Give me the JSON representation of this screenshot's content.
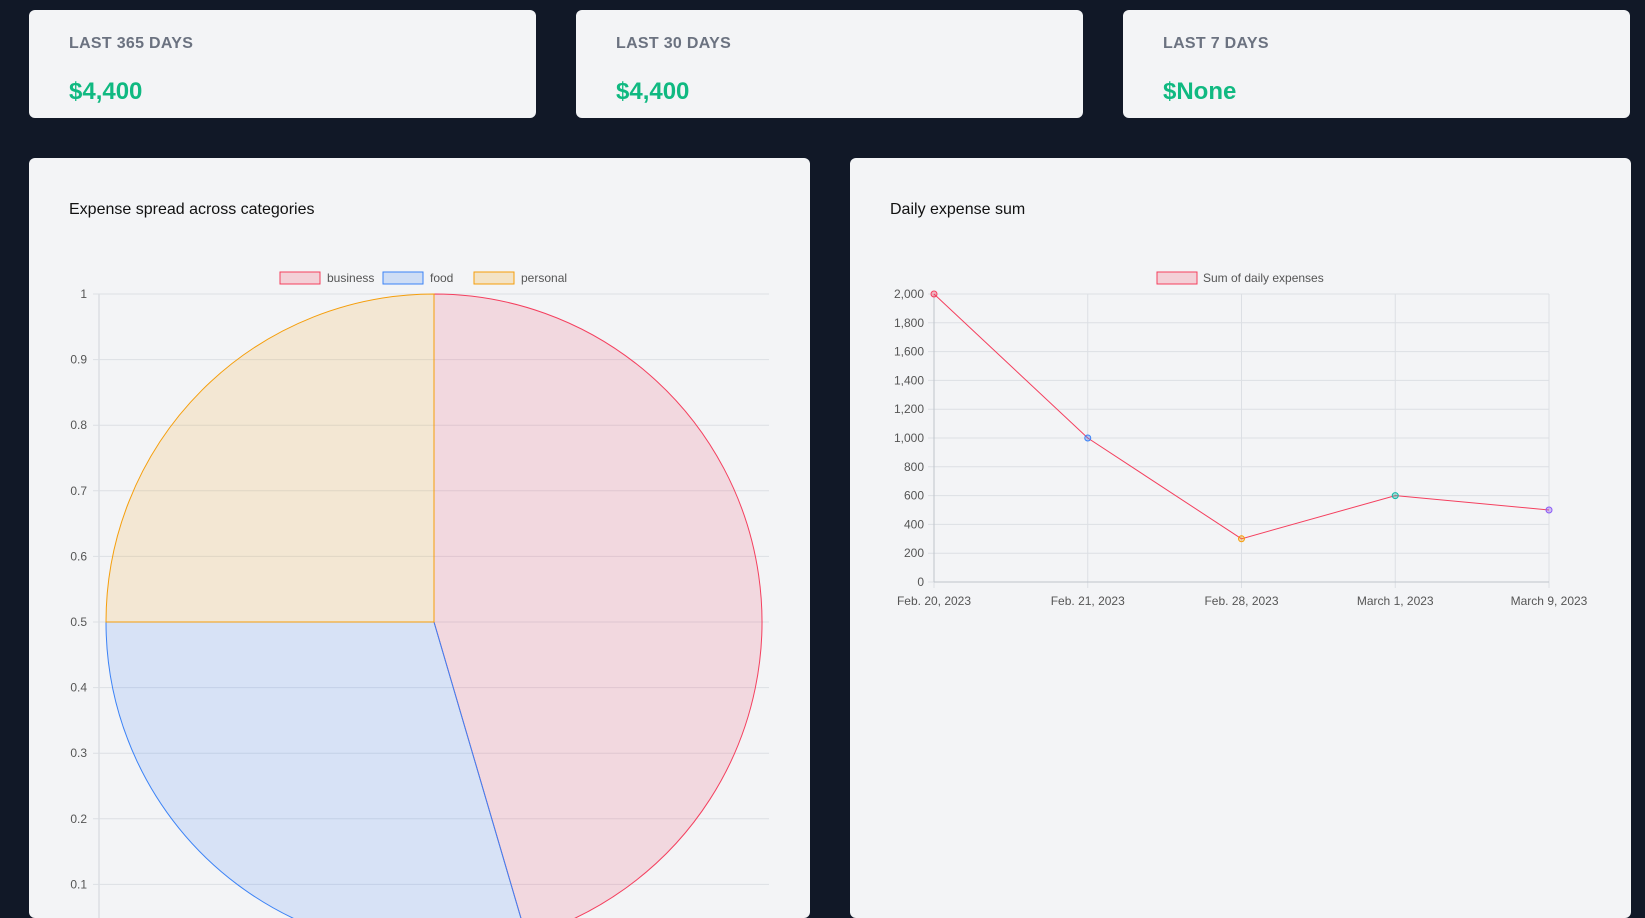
{
  "stats": [
    {
      "title": "LAST 365 DAYS",
      "value": "$4,400"
    },
    {
      "title": "LAST 30 DAYS",
      "value": "$4,400"
    },
    {
      "title": "LAST 7 DAYS",
      "value": "$None"
    }
  ],
  "pie_card": {
    "title": "Expense spread across categories"
  },
  "line_card": {
    "title": "Daily expense sum"
  },
  "colors": {
    "page_bg": "#111827",
    "card_bg": "#f3f4f6",
    "stat_value": "#10b981",
    "business": "#f43f5e",
    "food": "#3b82f6",
    "personal": "#f59e0b",
    "line": "#f43f5e"
  },
  "chart_data": [
    {
      "type": "pie",
      "title": "Expense spread across categories",
      "categories": [
        "business",
        "food",
        "personal"
      ],
      "values": [
        2000,
        1300,
        1100
      ],
      "y_ticks": [
        "1",
        "0.9",
        "0.8",
        "0.7",
        "0.6",
        "0.5",
        "0.4",
        "0.3",
        "0.2",
        "0.1"
      ],
      "legend": "top-center",
      "grid": true
    },
    {
      "type": "line",
      "title": "Daily expense sum",
      "series": [
        {
          "name": "Sum of daily expenses",
          "x": [
            "Feb. 20, 2023",
            "Feb. 21, 2023",
            "Feb. 28, 2023",
            "March 1, 2023",
            "March 9, 2023"
          ],
          "values": [
            2000,
            1000,
            300,
            600,
            500
          ]
        }
      ],
      "y_ticks": [
        "2,000",
        "1,800",
        "1,600",
        "1,400",
        "1,200",
        "1,000",
        "800",
        "600",
        "400",
        "200",
        "0"
      ],
      "ylim": [
        0,
        2000
      ],
      "legend": "top-center",
      "grid": true
    }
  ]
}
